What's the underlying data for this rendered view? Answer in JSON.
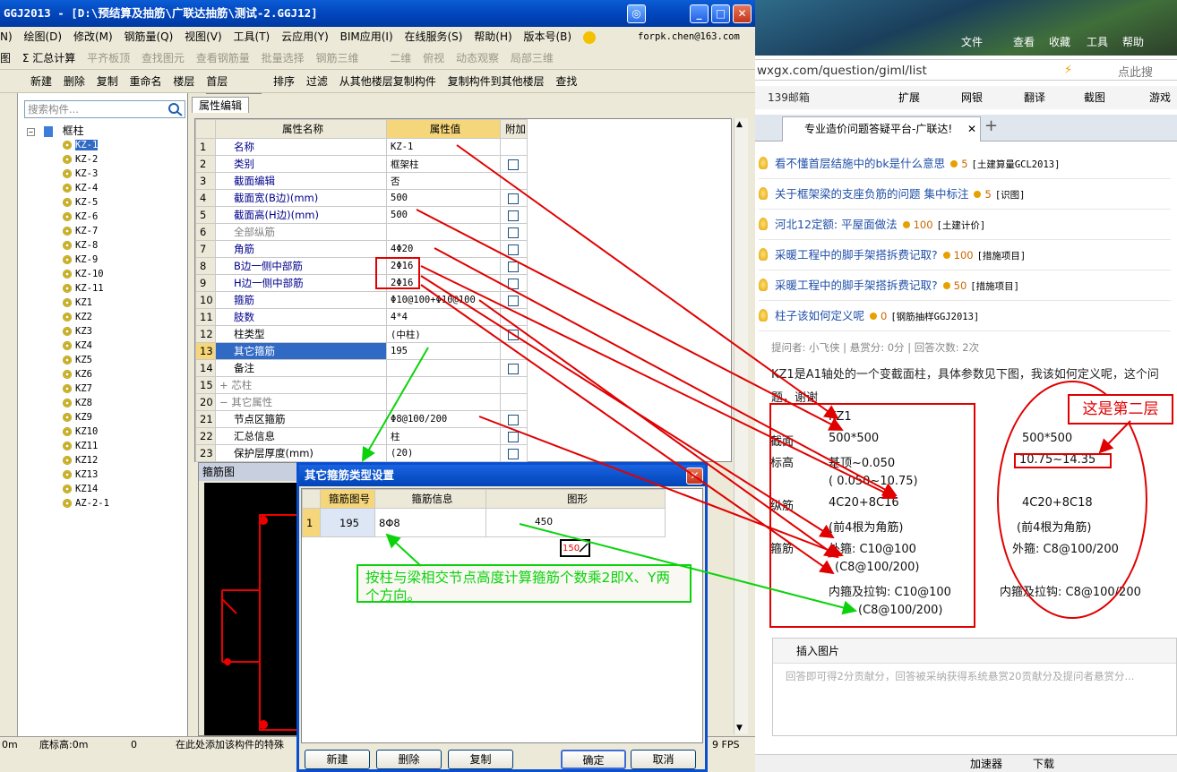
{
  "ggj": {
    "title": "GGJ2013 - [D:\\预结算及抽筋\\广联达抽筋\\测试-2.GGJ12]",
    "menu": [
      "N)",
      "绘图(D)",
      "修改(M)",
      "钢筋量(Q)",
      "视图(V)",
      "工具(T)",
      "云应用(Y)",
      "BIM应用(I)",
      "在线服务(S)",
      "帮助(H)",
      "版本号(B)"
    ],
    "user_email": "forpk.chen@163.com",
    "toolbar1": [
      "图",
      "Σ 汇总计算",
      "平齐板顶",
      "查找图元",
      "查看钢筋量",
      "批量选择",
      "钢筋三维",
      "二维",
      "俯视",
      "动态观察",
      "局部三维"
    ],
    "toolbar2": [
      "新建",
      "删除",
      "复制",
      "重命名",
      "楼层",
      "首层",
      "排序",
      "过滤",
      "从其他楼层复制构件",
      "复制构件到其他楼层",
      "查找"
    ],
    "search_placeholder": "搜索构件...",
    "tree_root": "框柱",
    "tree_items": [
      "KZ-1",
      "KZ-2",
      "KZ-3",
      "KZ-4",
      "KZ-5",
      "KZ-6",
      "KZ-7",
      "KZ-8",
      "KZ-9",
      "KZ-10",
      "KZ-11",
      "KZ1",
      "KZ2",
      "KZ3",
      "KZ4",
      "KZ5",
      "KZ6",
      "KZ7",
      "KZ8",
      "KZ9",
      "KZ10",
      "KZ11",
      "KZ12",
      "KZ13",
      "KZ14",
      "AZ-2-1"
    ],
    "tab_label": "属性编辑",
    "grid_headers": [
      "",
      "属性名称",
      "属性值",
      "附加"
    ],
    "grid_rows": [
      {
        "n": "1",
        "k": "名称",
        "v": "KZ-1",
        "cb": false,
        "c": "bl"
      },
      {
        "n": "2",
        "k": "类别",
        "v": "框架柱",
        "cb": true,
        "c": "bl"
      },
      {
        "n": "3",
        "k": "截面编辑",
        "v": "否",
        "cb": false,
        "c": "bl"
      },
      {
        "n": "4",
        "k": "截面宽(B边)(mm)",
        "v": "500",
        "cb": true,
        "c": "bl"
      },
      {
        "n": "5",
        "k": "截面高(H边)(mm)",
        "v": "500",
        "cb": true,
        "c": "bl"
      },
      {
        "n": "6",
        "k": "全部纵筋",
        "v": "",
        "cb": true,
        "c": "gr"
      },
      {
        "n": "7",
        "k": "角筋",
        "v": "4Φ20",
        "cb": true,
        "c": "bl"
      },
      {
        "n": "8",
        "k": "B边一侧中部筋",
        "v": "2Φ16",
        "cb": true,
        "c": "bl"
      },
      {
        "n": "9",
        "k": "H边一侧中部筋",
        "v": "2Φ16",
        "cb": true,
        "c": "bl"
      },
      {
        "n": "10",
        "k": "箍筋",
        "v": "Φ10@100+Φ10@100",
        "cb": true,
        "c": "bl"
      },
      {
        "n": "11",
        "k": "肢数",
        "v": "4*4",
        "cb": false,
        "c": "bl"
      },
      {
        "n": "12",
        "k": "柱类型",
        "v": "(中柱)",
        "cb": true,
        "c": ""
      },
      {
        "n": "13",
        "k": "其它箍筋",
        "v": "195",
        "cb": false,
        "c": "sel"
      },
      {
        "n": "14",
        "k": "备注",
        "v": "",
        "cb": true,
        "c": ""
      },
      {
        "n": "15",
        "k": "+ 芯柱",
        "v": "",
        "cb": false,
        "c": "gr"
      },
      {
        "n": "20",
        "k": "− 其它属性",
        "v": "",
        "cb": false,
        "c": "gr"
      },
      {
        "n": "21",
        "k": "节点区箍筋",
        "v": "Φ8@100/200",
        "cb": true,
        "c": ""
      },
      {
        "n": "22",
        "k": "汇总信息",
        "v": "柱",
        "cb": true,
        "c": ""
      },
      {
        "n": "23",
        "k": "保护层厚度(mm)",
        "v": "(20)",
        "cb": true,
        "c": ""
      }
    ],
    "stirrup_title": "箍筋图",
    "status": [
      "0m",
      "底标高:0m",
      "0",
      "在此处添加该构件的特殊",
      "9 FPS"
    ],
    "dialog": {
      "title": "其它箍筋类型设置",
      "headers": [
        "",
        "箍筋图号",
        "箍筋信息",
        "图形"
      ],
      "row": {
        "n": "1",
        "no": "195",
        "info": "8Φ8",
        "len1": "450",
        "len2": "150"
      },
      "buttons": [
        "新建",
        "删除",
        "复制",
        "确定",
        "取消"
      ]
    }
  },
  "browser": {
    "menu": [
      "文件",
      "查看",
      "收藏",
      "工具",
      "帮助"
    ],
    "url": "wxgx.com/question/giml/list",
    "search_hint": "点此搜",
    "bookmarks": [
      "139邮箱",
      "扩展",
      "网银",
      "翻译",
      "截图",
      "游戏"
    ],
    "tab_title": "专业造价问题答疑平台-广联达!",
    "questions": [
      {
        "title": "看不懂首层结施中的bk是什么意思",
        "points": "5",
        "tag": "[土建算量GCL2013]"
      },
      {
        "title": "关于框架梁的支座负筋的问题 集中标注",
        "points": "5",
        "tag": "[识图]"
      },
      {
        "title": "河北12定额: 平屋面做法",
        "points": "100",
        "tag": "[土建计价]"
      },
      {
        "title": "采暖工程中的脚手架搭拆费记取?",
        "points": "100",
        "tag": "[措施项目]"
      },
      {
        "title": "采暖工程中的脚手架搭拆费记取?",
        "points": "50",
        "tag": "[措施项目]"
      },
      {
        "title": "柱子该如何定义呢",
        "points": "0",
        "tag": "[钢筋抽样GGJ2013]"
      }
    ],
    "meta": "提问者: 小飞侠   |   悬赏分: 0分   |   回答次数: 2次",
    "body_line1": "KZ1是A1轴处的一个变截面柱，具体参数见下图，我该如何定义呢，这个问",
    "body_line2": "题，谢谢",
    "spec": {
      "kz1": "KZ1",
      "sec_label": "截面",
      "sec1": "500*500",
      "sec2": "500*500",
      "elev_label": "标高",
      "elev1": "基顶~0.050",
      "elev1b": "( 0.050~10.75)",
      "elev2": "10.75~14.35",
      "long_label": "纵筋",
      "long1": "4C20+8C16",
      "long2": "4C20+8C18",
      "corner1": "(前4根为角筋)",
      "corner2": "(前4根为角筋)",
      "stir_label": "箍筋",
      "out1": "外箍: C10@100",
      "out2": "外箍: C8@100/200",
      "out1b": "(C8@100/200)",
      "in1": "内箍及拉钩: C10@100",
      "in2": "内箍及拉钩: C8@100/200",
      "in1b": "(C8@100/200)"
    },
    "annotation_second_floor": "这是第二层",
    "green_note": "按柱与梁相交节点高度计算箍筋个数乘2即X、Y两个方向。",
    "editor_button": "插入图片",
    "editor_placeholder": "回答即可得2分贡献分，回答被采纳获得系统悬赏20贡献分及提问者悬赏分...",
    "status": [
      "加速器",
      "下载"
    ]
  },
  "colors": {
    "annotation_red": "#e00000",
    "annotation_green": "#0bd30b",
    "selection_blue": "#316ac5",
    "header_gold": "#f6d67a"
  }
}
